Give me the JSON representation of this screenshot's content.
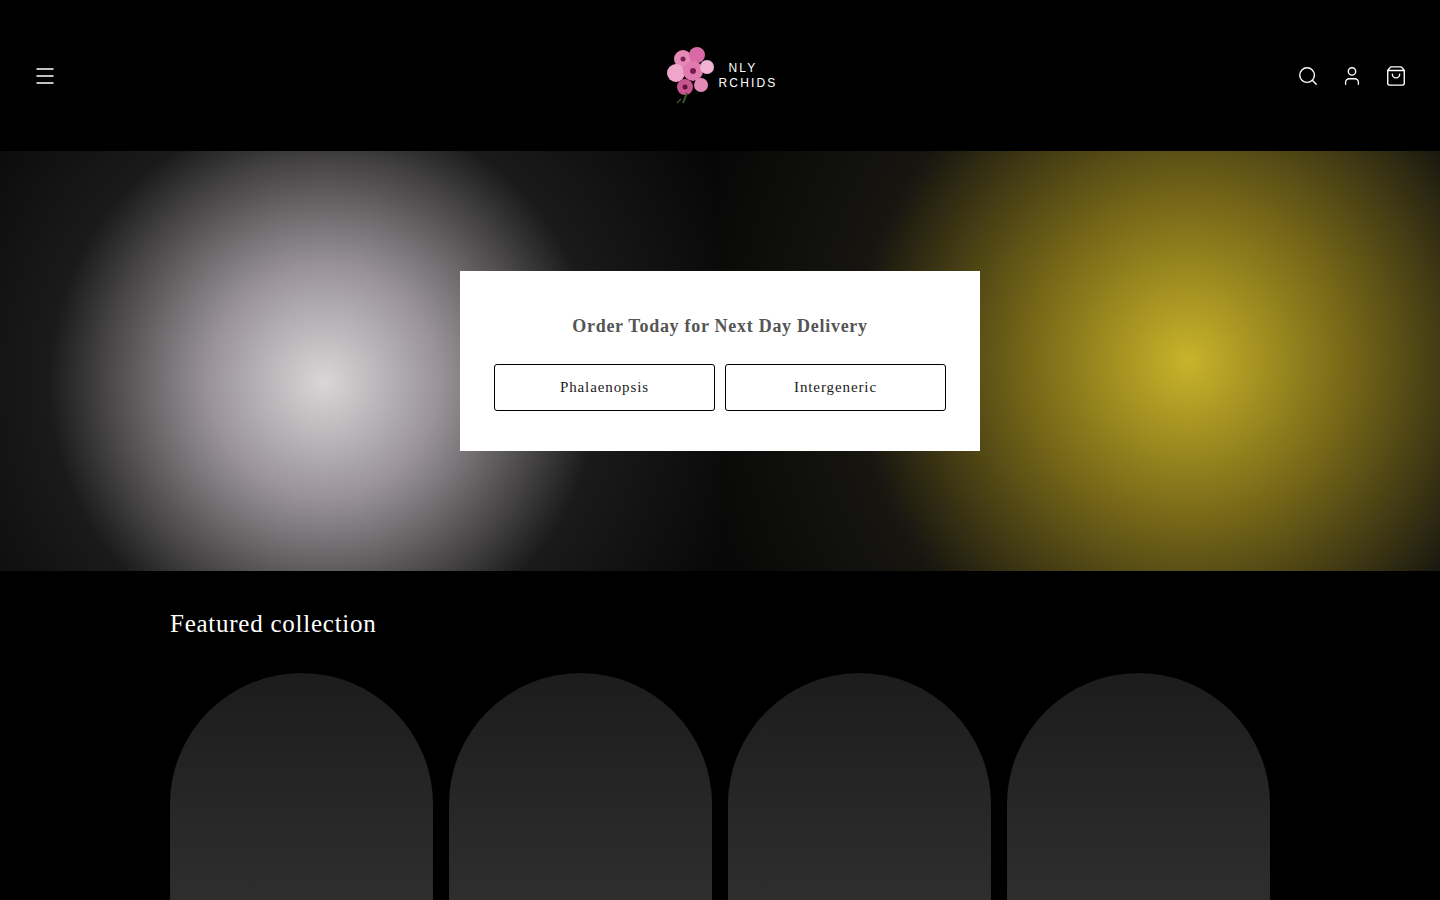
{
  "logo": {
    "lines": [
      "NLY",
      "RCHIDS"
    ]
  },
  "hero": {
    "banner": {
      "title": "Order Today for Next Day Delivery",
      "buttons": [
        "Phalaenopsis",
        "Intergeneric"
      ]
    }
  },
  "featured": {
    "title": "Featured collection"
  }
}
